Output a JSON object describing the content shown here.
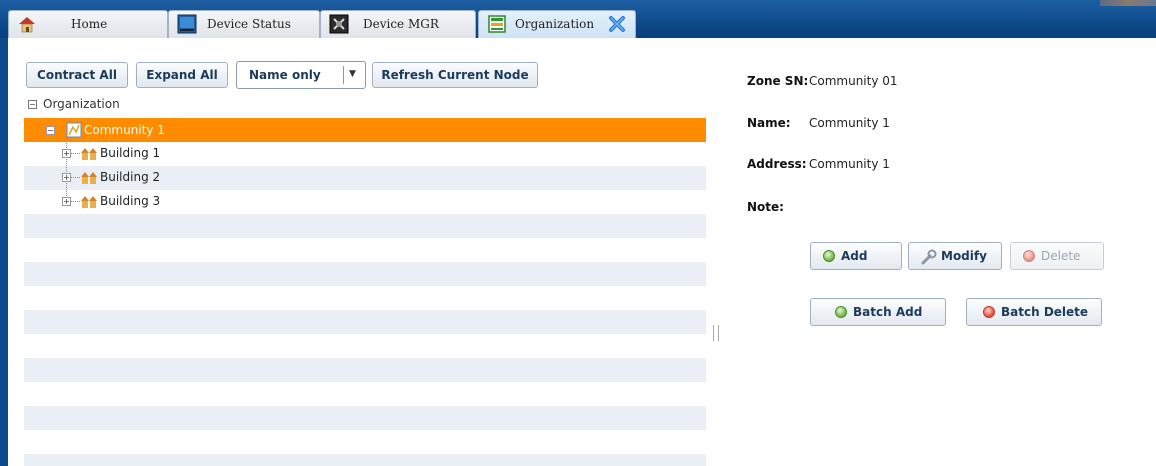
{
  "tabs": [
    {
      "label": "Home",
      "icon": "home-icon"
    },
    {
      "label": "Device Status",
      "icon": "monitor-icon"
    },
    {
      "label": "Device MGR",
      "icon": "device-manager-icon"
    },
    {
      "label": "Organization",
      "icon": "organization-icon",
      "active": true
    }
  ],
  "toolbar": {
    "contract_all": "Contract All",
    "expand_all": "Expand All",
    "view_select": "Name only",
    "refresh": "Refresh Current Node"
  },
  "tree": {
    "root": "Organization",
    "selected": "Community 1",
    "children": [
      "Building 1",
      "Building 2",
      "Building 3"
    ]
  },
  "details": {
    "zone_sn_label": "Zone SN:",
    "zone_sn_value": "Community 01",
    "name_label": "Name:",
    "name_value": "Community 1",
    "address_label": "Address:",
    "address_value": "Community 1",
    "note_label": "Note:",
    "note_value": ""
  },
  "actions": {
    "add": "Add",
    "modify": "Modify",
    "delete": "Delete",
    "batch_add": "Batch Add",
    "batch_delete": "Batch Delete"
  },
  "colors": {
    "tabbar": "#0d4a8c",
    "selected_row": "#ff8c00",
    "alt_row": "#eaeff6"
  }
}
